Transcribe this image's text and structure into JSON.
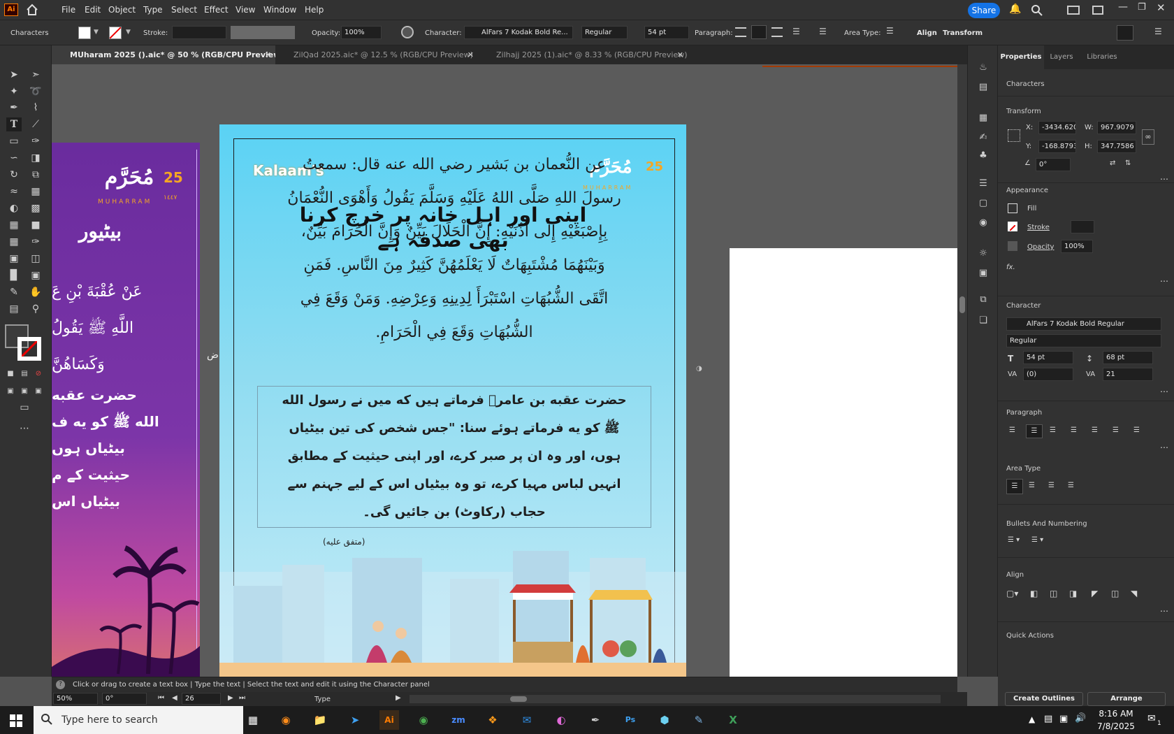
{
  "app": {
    "logo": "Ai",
    "logo_color": "#ff7c00"
  },
  "menu": [
    "File",
    "Edit",
    "Object",
    "Type",
    "Select",
    "Effect",
    "View",
    "Window",
    "Help"
  ],
  "share_label": "Share",
  "control_bar": {
    "selection_label": "Characters",
    "stroke_label": "Stroke:",
    "opacity_label": "Opacity:",
    "opacity_value": "100%",
    "character_label": "Character:",
    "font_name": "AlFars 7 Kodak Bold Re...",
    "font_style": "Regular",
    "font_size": "54 pt",
    "paragraph_label": "Paragraph:",
    "area_type_label": "Area Type:",
    "align_label": "Align",
    "transform_label": "Transform"
  },
  "tabs": [
    {
      "label": "MUharam 2025 ().aic* @ 50 % (RGB/CPU Preview)",
      "active": true
    },
    {
      "label": "ZilQad 2025.aic* @ 12.5 % (RGB/CPU Preview)",
      "active": false
    },
    {
      "label": "Zilhajj 2025 (1).aic* @ 8.33 % (RGB/CPU Preview)",
      "active": false
    }
  ],
  "artboard_left": {
    "date_num": "25",
    "title_ar": "مُحَرَّم",
    "subtitle": "MUHARRAM",
    "year": "١٤٤٧",
    "heading_ur": "بیٹیور",
    "arabic_lines": [
      "عَنْ عُقْبَةَ بْنِ عَ",
      "اللَّهِ ﷺ يَقُولُ",
      "وَكَسَاهُنَّ"
    ],
    "urdu_lines": [
      "حضرت عقبه",
      "الله ﷺ کو یه ف",
      "بیٹیاں ہوں",
      "حیثیت کے م",
      "بیٹیاں اس"
    ],
    "bg_color": "#7a2fa8"
  },
  "artboard_main": {
    "logo_text": "Kalaam's",
    "date_num": "25",
    "title_ar": "مُحَرَّم",
    "subtitle": "MUHARRAM",
    "headline": "اپنی اور اہل خانہ پر خرچ کرنا بھی صدقہ ہے",
    "arabic_lines": [
      "عن النُّعمان بن بَشير رضي الله عنه قال: سمعتُ",
      "رسولَ اللهِ صَلَّى اللهُ عَلَيْهِ وَسَلَّمَ يَقُولُ وَأَهْوَى النُّعْمَانُ",
      "بِإِصْبَعَيْهِ إِلَى أُذُنَيْهِ: إِنَّ الْحَلَالَ بَيِّنٌ وَإِنَّ الْحَرَامَ بَيِّنٌ،",
      "وَبَيْنَهُمَا مُشْتَبِهَاتٌ لَا يَعْلَمُهُنَّ كَثِيرٌ مِنَ النَّاسِ. فَمَنِ",
      "اتَّقَى الشُّبُهَاتِ اسْتَبْرَأَ لِدِينِهِ وَعِرْضِهِ. وَمَنْ وَقَعَ فِي",
      "الشُّبُهَاتِ وَقَعَ فِي الْحَرَامِ."
    ],
    "urdu_lines": [
      "حضرت عقبه بن عامرؓ فرماتے ہیں که میں نے رسول الله",
      "ﷺ کو یه فرماتے ہوئے سنا: \"جس شخص کی تین بیٹیاں",
      "ہوں، اور وہ ان پر صبر کرے، اور اپنی حیثیت کے مطابق",
      "انہیں لباس مہیا کرے، تو وہ بیٹیاں اس کے لیے جہنم سے",
      "حجاب (رکاوٹ) بن جائیں گی۔"
    ],
    "reference": "(متفق علیه)",
    "bg_top": "#5ad2f4",
    "bg_bottom": "#c7ecf7"
  },
  "panel": {
    "tabs": [
      "Properties",
      "Layers",
      "Libraries"
    ],
    "selection": "Characters",
    "transform_title": "Transform",
    "x_label": "X:",
    "x_value": "-3434.6206",
    "y_label": "Y:",
    "y_value": "-168.8793 |",
    "w_label": "W:",
    "w_value": "967.9079 p",
    "h_label": "H:",
    "h_value": "347.7586 p",
    "rotate_value": "0°",
    "appearance_title": "Appearance",
    "fill_label": "Fill",
    "stroke_label": "Stroke",
    "opacity_label": "Opacity",
    "opacity_value": "100%",
    "fx_label": "fx.",
    "character_title": "Character",
    "font_name": "AlFars 7 Kodak Bold Regular",
    "font_style": "Regular",
    "font_size": "54 pt",
    "leading": "68 pt",
    "kerning": "(0)",
    "tracking": "21",
    "paragraph_title": "Paragraph",
    "area_type_title": "Area Type",
    "bullets_title": "Bullets And Numbering",
    "align_title": "Align",
    "quick_actions_title": "Quick Actions",
    "create_outlines": "Create Outlines",
    "arrange": "Arrange"
  },
  "status": {
    "hint": "Click or drag to create a text box  |  Type the text  |  Select the text and edit it using the Character panel",
    "zoom": "50%",
    "rotation": "0°",
    "artboard_num": "26",
    "tool_name": "Type"
  },
  "taskbar": {
    "search_placeholder": "Type here to search",
    "time": "8:16 AM",
    "date": "7/8/2025",
    "notif_count": "1",
    "apps": [
      "task-view",
      "firefox",
      "file-explorer",
      "vscode",
      "illustrator",
      "chrome",
      "zoom",
      "app-orange",
      "outlook",
      "app-gradient",
      "pen-tool",
      "photoshop",
      "app-cube",
      "notes",
      "excel"
    ]
  }
}
